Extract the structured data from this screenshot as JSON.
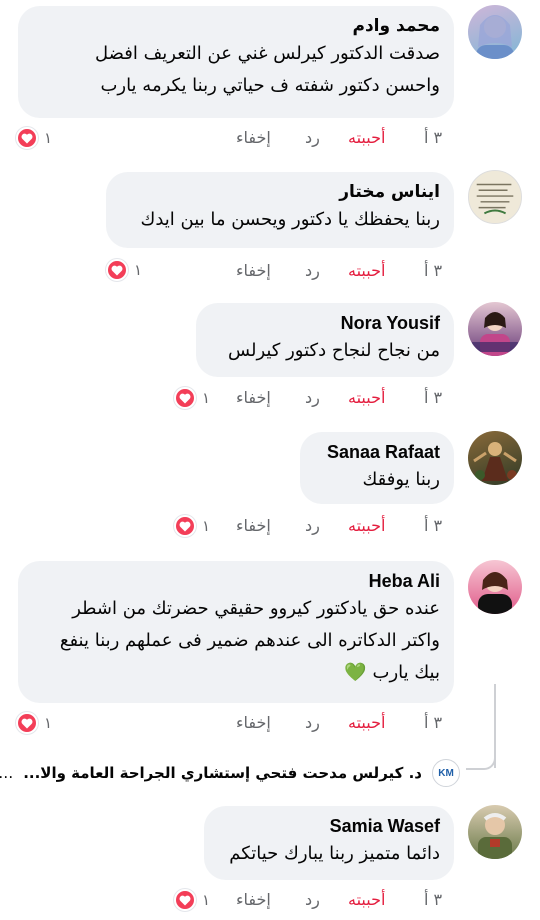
{
  "comments": [
    {
      "author": "محمد وادم",
      "lines": [
        "صدقت الدكتور كيرلس غني عن التعريف افضل",
        "واحسن دكتور شفته ف حياتي ربنا يكرمه يارب"
      ],
      "time": "٣ أ",
      "like_label": "أحببته",
      "reply_label": "رد",
      "hide_label": "إخفاء",
      "reaction_count": "١",
      "avatar_colors": [
        "#cfb6d8",
        "#7fb6d6"
      ]
    },
    {
      "author": "ايناس مختار",
      "lines": [
        "ربنا يحفظك يا دكتور ويحسن ما بين ايدك"
      ],
      "time": "٣ أ",
      "like_label": "أحببته",
      "reply_label": "رد",
      "hide_label": "إخفاء",
      "reaction_count": "١",
      "avatar_colors": [
        "#e9e4d6",
        "#b7ad93"
      ]
    },
    {
      "author": "Nora Yousif",
      "lines": [
        "من نجاح لنجاح دكتور كيرلس"
      ],
      "time": "٣ أ",
      "like_label": "أحببته",
      "reply_label": "رد",
      "hide_label": "إخفاء",
      "reaction_count": "١",
      "avatar_colors": [
        "#d7b7c8",
        "#5a2f6a"
      ]
    },
    {
      "author": "Sanaa Rafaat",
      "lines": [
        "ربنا يوفقك"
      ],
      "time": "٣ أ",
      "like_label": "أحببته",
      "reply_label": "رد",
      "hide_label": "إخفاء",
      "reaction_count": "١",
      "avatar_colors": [
        "#7a5a33",
        "#2e3f28"
      ]
    },
    {
      "author": "Heba Ali",
      "lines": [
        "عنده حق يادكتور كيروو حقيقي حضرتك من اشطر",
        "واكتر الدكاتره الى عندهم ضمير فى عملهم ربنا ينفع",
        "بيك يارب 💚"
      ],
      "time": "٣ أ",
      "like_label": "أحببته",
      "reply_label": "رد",
      "hide_label": "إخفاء",
      "reaction_count": "١",
      "avatar_colors": [
        "#f2b8c8",
        "#c23b6a"
      ]
    },
    {
      "author": "Samia Wasef",
      "lines": [
        "دائما متميز ربنا يبارك حياتكم"
      ],
      "time": "٣ أ",
      "like_label": "أحببته",
      "reply_label": "رد",
      "hide_label": "إخفاء",
      "reaction_count": "١",
      "avatar_colors": [
        "#c9b89a",
        "#5b6a3f"
      ]
    }
  ],
  "reply_preview": {
    "text": "د. كيرلس مدحت فتحي إستشاري الجراحة العامة والا...",
    "more": "…",
    "logo_text": "KM"
  },
  "icons": {
    "heart": "heart-icon",
    "accent_like": "#e41e3f",
    "reaction_bg": "#f33e58",
    "bubble_bg": "#f0f2f5",
    "meta_text": "#65676b"
  }
}
